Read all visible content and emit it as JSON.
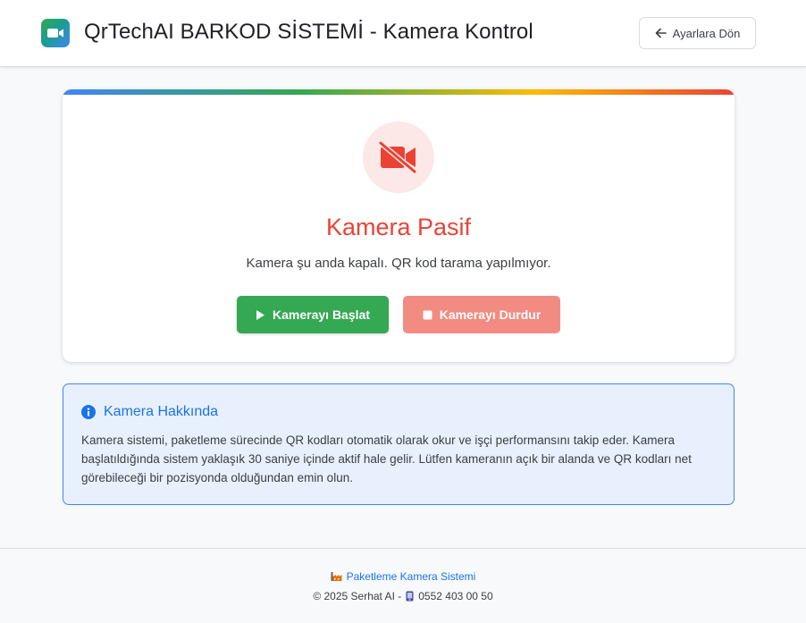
{
  "header": {
    "title": "QrTechAI BARKOD SİSTEMİ - Kamera Kontrol",
    "back_label": "Ayarlara Dön",
    "logo_icon": "video-camera-icon"
  },
  "camera_card": {
    "status_title": "Kamera Pasif",
    "status_description": "Kamera şu anda kapalı. QR kod tarama yapılmıyor.",
    "start_label": "Kamerayı Başlat",
    "stop_label": "Kamerayı Durdur",
    "status_icon": "video-camera-off-icon"
  },
  "info_box": {
    "title": "Kamera Hakkında",
    "text": "Kamera sistemi, paketleme sürecinde QR kodları otomatik olarak okur ve işçi performansını takip eder. Kamera başlatıldığında sistem yaklaşık 30 saniye içinde aktif hale gelir. Lütfen kameranın açık bir alanda ve QR kodları net görebileceği bir pozisyonda olduğundan emin olun.",
    "icon": "info-icon"
  },
  "footer": {
    "system_label": "Paketleme Kamera Sistemi",
    "copyright": "© 2025 Serhat AI -",
    "phone": "0552 403 00 50"
  },
  "colors": {
    "accent_blue": "#1a73e8",
    "success_green": "#34a853",
    "danger_red": "#ea4335",
    "stop_disabled": "#f28b82"
  }
}
